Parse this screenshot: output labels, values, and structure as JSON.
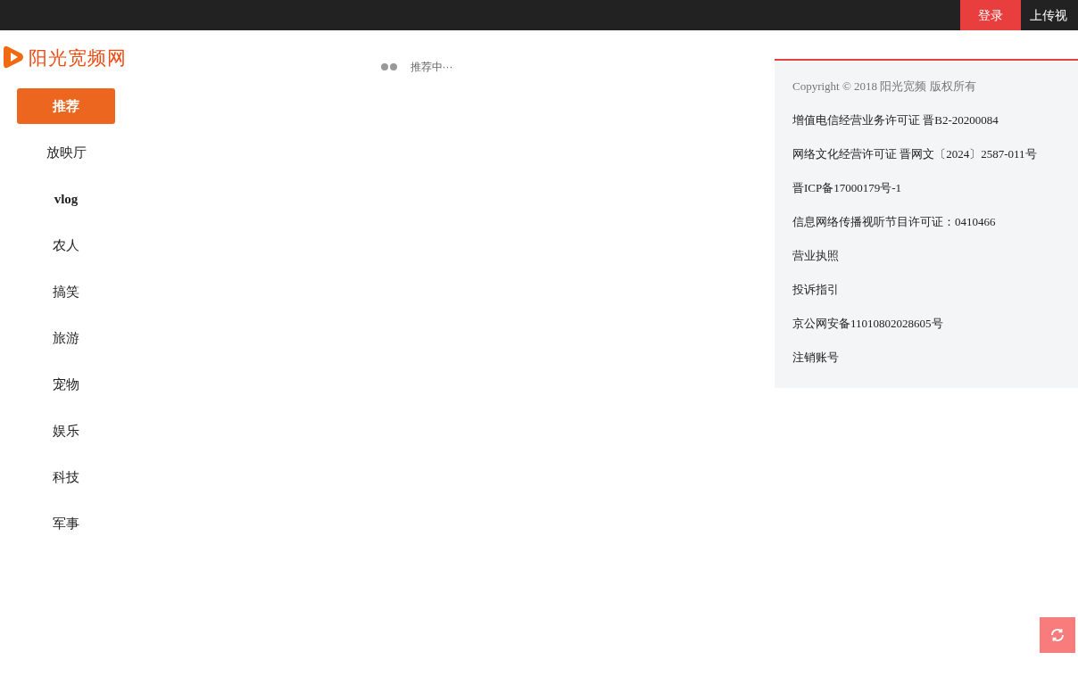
{
  "top_bar": {
    "login": "登录",
    "upload": "上传视"
  },
  "logo": {
    "text": "阳光宽频网"
  },
  "nav": [
    {
      "label": "推荐",
      "selected": true,
      "bold": true
    },
    {
      "label": "放映厅",
      "selected": false,
      "bold": false
    },
    {
      "label": "vlog",
      "selected": false,
      "bold": true
    },
    {
      "label": "农人",
      "selected": false,
      "bold": false
    },
    {
      "label": "搞笑",
      "selected": false,
      "bold": false
    },
    {
      "label": "旅游",
      "selected": false,
      "bold": false
    },
    {
      "label": "宠物",
      "selected": false,
      "bold": false
    },
    {
      "label": "娱乐",
      "selected": false,
      "bold": false
    },
    {
      "label": "科技",
      "selected": false,
      "bold": false
    },
    {
      "label": "军事",
      "selected": false,
      "bold": false
    }
  ],
  "loading": {
    "text": "推荐中···"
  },
  "footer": {
    "copyright": "Copyright © 2018 阳光宽频 版权所有",
    "links": [
      "增值电信经营业务许可证 晋B2-20200084",
      "网络文化经营许可证 晋网文〔2024〕2587-011号",
      "晋ICP备17000179号-1",
      "信息网络传播视听节目许可证：0410466",
      "营业执照",
      "投诉指引",
      "京公网安备11010802028605号",
      "注销账号"
    ]
  }
}
